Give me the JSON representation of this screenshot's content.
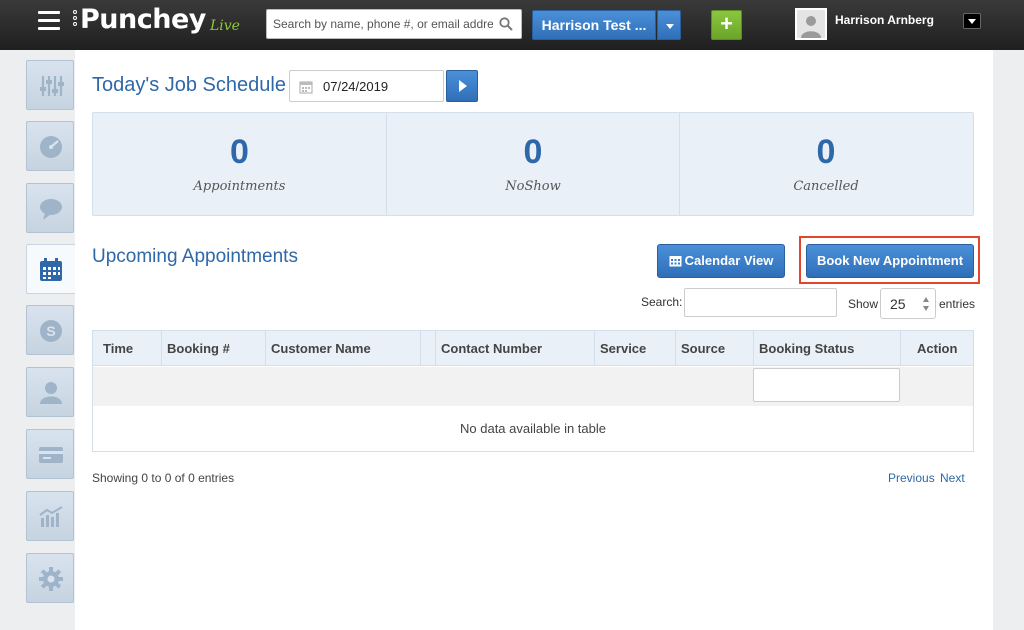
{
  "topbar": {
    "logo": "Punchey",
    "logo_suffix": "Live",
    "search_placeholder": "Search by name, phone #, or email address",
    "account_label": "Harrison Test ...",
    "add_label": "+",
    "user_name": "Harrison Arnberg"
  },
  "sidebar": {
    "items": [
      {
        "icon": "sliders-icon"
      },
      {
        "icon": "dashboard-icon"
      },
      {
        "icon": "chat-icon"
      },
      {
        "icon": "calendar-icon",
        "active": true
      },
      {
        "icon": "dollar-icon"
      },
      {
        "icon": "user-icon"
      },
      {
        "icon": "card-icon"
      },
      {
        "icon": "reports-icon"
      },
      {
        "icon": "gear-icon"
      }
    ]
  },
  "schedule": {
    "title": "Today's Job Schedule",
    "date": "07/24/2019"
  },
  "stats": [
    {
      "value": "0",
      "label": "Appointments"
    },
    {
      "value": "0",
      "label": "NoShow"
    },
    {
      "value": "0",
      "label": "Cancelled"
    }
  ],
  "upcoming": {
    "title": "Upcoming Appointments",
    "calendar_view_label": "Calendar View",
    "book_new_label": "Book New Appointment",
    "search_label": "Search:",
    "show_label": "Show",
    "entries_value": "25",
    "entries_label": "entries",
    "columns": [
      "Time",
      "Booking #",
      "Customer Name",
      "",
      "Contact Number",
      "Service",
      "Source",
      "Booking Status",
      "Action"
    ],
    "empty_message": "No data available in table",
    "info": "Showing 0 to 0 of 0 entries",
    "previous": "Previous",
    "next": "Next"
  },
  "colors": {
    "accent": "#2f68a8",
    "button_blue": "#3a7dc8",
    "add_green": "#7ab833",
    "highlight": "#e2452c"
  }
}
